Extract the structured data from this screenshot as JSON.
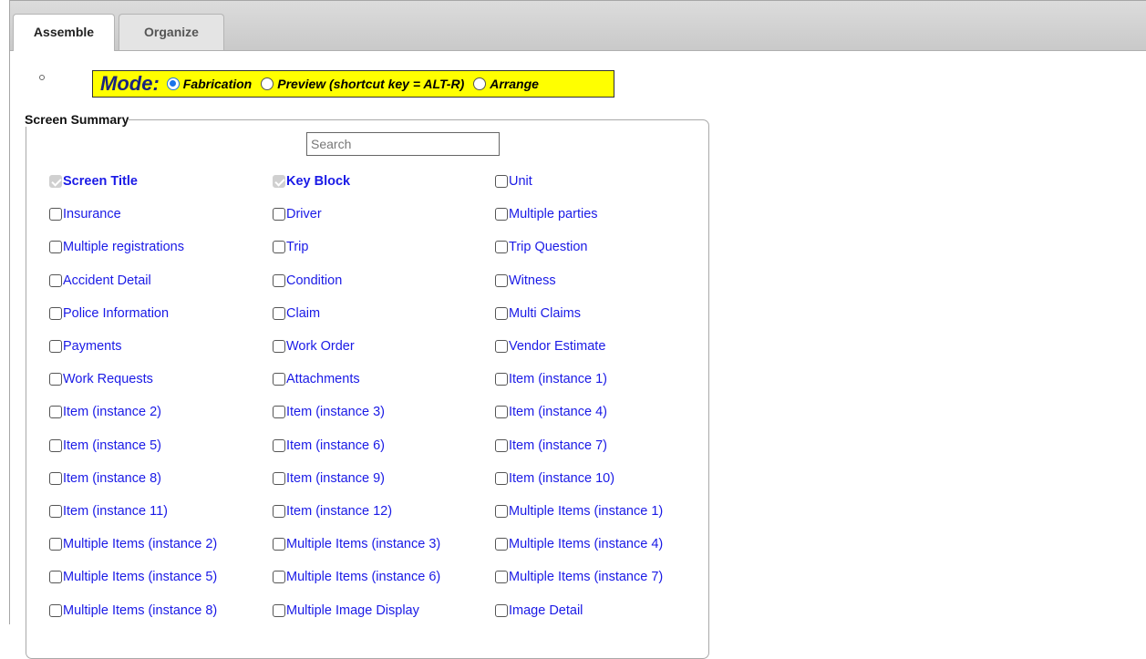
{
  "tabs": [
    {
      "label": "Assemble",
      "active": true
    },
    {
      "label": "Organize",
      "active": false
    }
  ],
  "mode": {
    "label": "Mode:",
    "options": [
      {
        "label": "Fabrication",
        "selected": true
      },
      {
        "label": "Preview (shortcut key = ALT-R)",
        "selected": false
      },
      {
        "label": "Arrange",
        "selected": false
      }
    ]
  },
  "summary": {
    "legend": "Screen Summary",
    "search_placeholder": "Search",
    "items": [
      {
        "label": "Screen Title",
        "checked": true,
        "disabled": true
      },
      {
        "label": "Key Block",
        "checked": true,
        "disabled": true
      },
      {
        "label": "Unit",
        "checked": false
      },
      {
        "label": "Insurance",
        "checked": false
      },
      {
        "label": "Driver",
        "checked": false
      },
      {
        "label": "Multiple parties",
        "checked": false
      },
      {
        "label": "Multiple registrations",
        "checked": false
      },
      {
        "label": "Trip",
        "checked": false
      },
      {
        "label": "Trip Question",
        "checked": false
      },
      {
        "label": "Accident Detail",
        "checked": false
      },
      {
        "label": "Condition",
        "checked": false
      },
      {
        "label": "Witness",
        "checked": false
      },
      {
        "label": "Police Information",
        "checked": false
      },
      {
        "label": "Claim",
        "checked": false
      },
      {
        "label": "Multi Claims",
        "checked": false
      },
      {
        "label": "Payments",
        "checked": false
      },
      {
        "label": "Work Order",
        "checked": false
      },
      {
        "label": "Vendor Estimate",
        "checked": false
      },
      {
        "label": "Work Requests",
        "checked": false
      },
      {
        "label": "Attachments",
        "checked": false
      },
      {
        "label": "Item (instance 1)",
        "checked": false
      },
      {
        "label": "Item (instance 2)",
        "checked": false
      },
      {
        "label": "Item (instance 3)",
        "checked": false
      },
      {
        "label": "Item (instance 4)",
        "checked": false
      },
      {
        "label": "Item (instance 5)",
        "checked": false
      },
      {
        "label": "Item (instance 6)",
        "checked": false
      },
      {
        "label": "Item (instance 7)",
        "checked": false
      },
      {
        "label": "Item (instance 8)",
        "checked": false
      },
      {
        "label": "Item (instance 9)",
        "checked": false
      },
      {
        "label": "Item (instance 10)",
        "checked": false
      },
      {
        "label": "Item (instance 11)",
        "checked": false
      },
      {
        "label": "Item (instance 12)",
        "checked": false
      },
      {
        "label": "Multiple Items (instance 1)",
        "checked": false
      },
      {
        "label": "Multiple Items (instance 2)",
        "checked": false
      },
      {
        "label": "Multiple Items (instance 3)",
        "checked": false
      },
      {
        "label": "Multiple Items (instance 4)",
        "checked": false
      },
      {
        "label": "Multiple Items (instance 5)",
        "checked": false
      },
      {
        "label": "Multiple Items (instance 6)",
        "checked": false
      },
      {
        "label": "Multiple Items (instance 7)",
        "checked": false
      },
      {
        "label": "Multiple Items (instance 8)",
        "checked": false
      },
      {
        "label": "Multiple Image Display",
        "checked": false
      },
      {
        "label": "Image Detail",
        "checked": false
      }
    ]
  }
}
